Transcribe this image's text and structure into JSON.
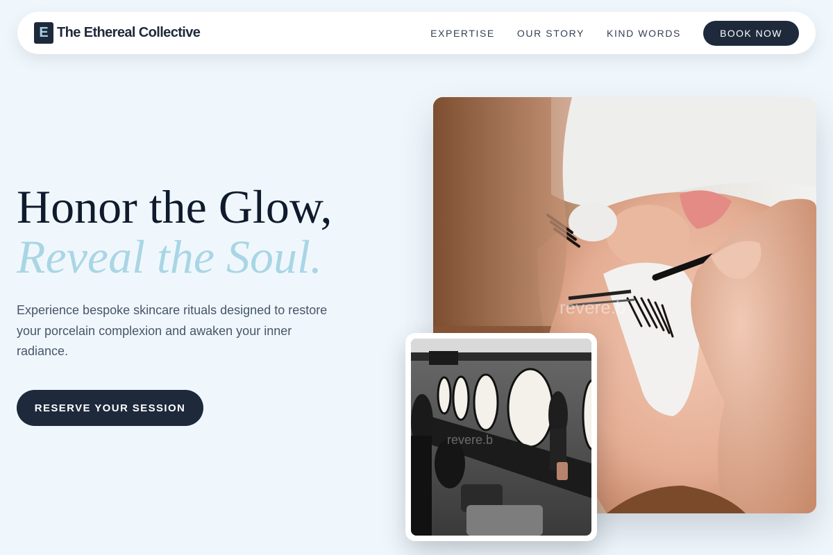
{
  "brand": {
    "mark": "E",
    "name": "The Ethereal Collective"
  },
  "nav": {
    "links": [
      "EXPERTISE",
      "OUR STORY",
      "KIND WORDS"
    ],
    "cta_label": "BOOK NOW"
  },
  "hero": {
    "headline_line1": "Honor the Glow,",
    "headline_line2": "Reveal the Soul.",
    "subtext": "Experience bespoke skincare rituals designed to restore your porcelain complexion and awaken your inner radiance.",
    "cta_label": "RESERVE YOUR SESSION"
  },
  "photos": {
    "main_watermark": "revere.b",
    "small_watermark": "revere.b"
  },
  "colors": {
    "background": "#f0f7fc",
    "navy": "#1e293b",
    "accent_blue": "#a9d6e5"
  }
}
